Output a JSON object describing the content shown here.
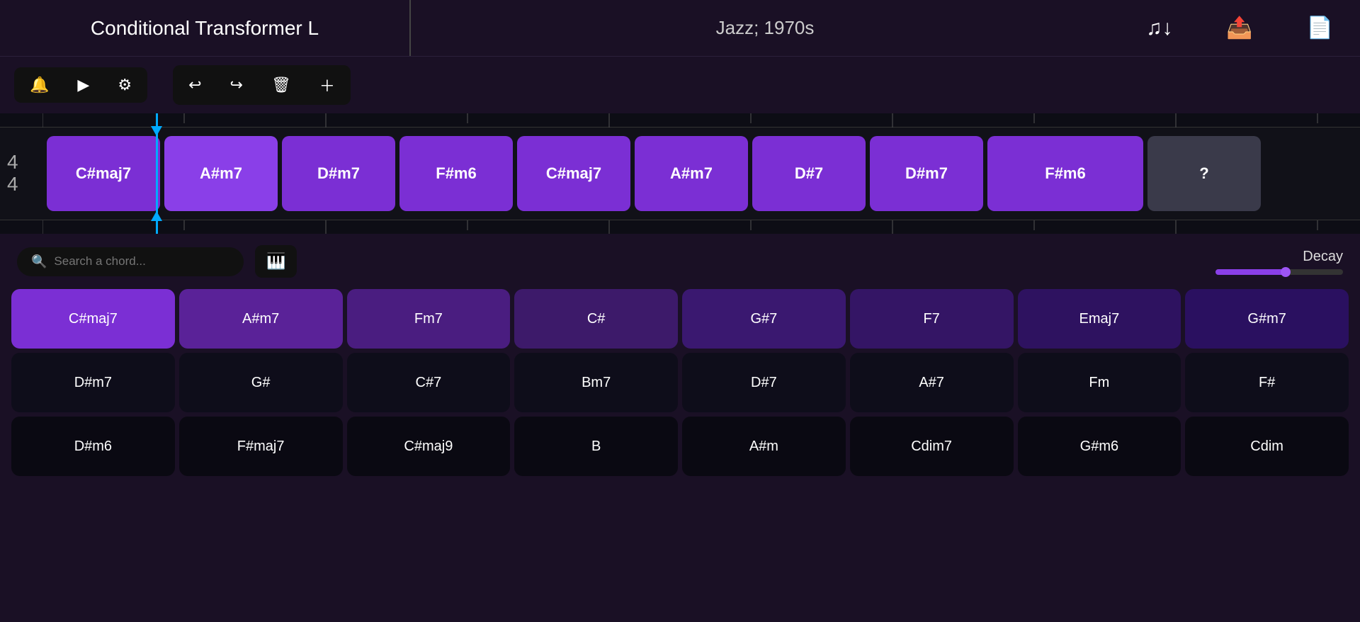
{
  "header": {
    "title": "Conditional Transformer L",
    "genre": "Jazz; 1970s",
    "icons": [
      "music-note-icon",
      "export-icon",
      "new-icon"
    ]
  },
  "toolbar": {
    "group1": [
      "bell-icon",
      "play-icon",
      "settings-icon"
    ],
    "group2": [
      "undo-icon",
      "redo-icon",
      "delete-icon",
      "add-icon"
    ]
  },
  "time_signature": {
    "top": "4",
    "bottom": "4"
  },
  "timeline_chords": [
    {
      "label": "C#maj7",
      "type": "normal"
    },
    {
      "label": "A#m7",
      "type": "active"
    },
    {
      "label": "D#m7",
      "type": "normal"
    },
    {
      "label": "F#m6",
      "type": "normal"
    },
    {
      "label": "C#maj7",
      "type": "normal"
    },
    {
      "label": "A#m7",
      "type": "normal"
    },
    {
      "label": "D#7",
      "type": "normal"
    },
    {
      "label": "D#m7",
      "type": "normal"
    },
    {
      "label": "F#m6",
      "type": "wide"
    },
    {
      "label": "?",
      "type": "unknown"
    }
  ],
  "search": {
    "placeholder": "Search a chord..."
  },
  "decay": {
    "label": "Decay",
    "value": 55
  },
  "chord_rows": [
    [
      {
        "label": "C#maj7",
        "style": "row1-0"
      },
      {
        "label": "A#m7",
        "style": "row1-1"
      },
      {
        "label": "Fm7",
        "style": "row1-2"
      },
      {
        "label": "C#",
        "style": "row1-3"
      },
      {
        "label": "G#7",
        "style": "row1-4"
      },
      {
        "label": "F7",
        "style": "row1-5"
      },
      {
        "label": "Emaj7",
        "style": "row1-6"
      },
      {
        "label": "G#m7",
        "style": "row1-7"
      }
    ],
    [
      {
        "label": "D#m7",
        "style": "row2"
      },
      {
        "label": "G#",
        "style": "row2"
      },
      {
        "label": "C#7",
        "style": "row2"
      },
      {
        "label": "Bm7",
        "style": "row2"
      },
      {
        "label": "D#7",
        "style": "row2"
      },
      {
        "label": "A#7",
        "style": "row2"
      },
      {
        "label": "Fm",
        "style": "row2"
      },
      {
        "label": "F#",
        "style": "row2"
      }
    ],
    [
      {
        "label": "D#m6",
        "style": "row3"
      },
      {
        "label": "F#maj7",
        "style": "row3"
      },
      {
        "label": "C#maj9",
        "style": "row3"
      },
      {
        "label": "B",
        "style": "row3"
      },
      {
        "label": "A#m",
        "style": "row3"
      },
      {
        "label": "Cdim7",
        "style": "row3"
      },
      {
        "label": "G#m6",
        "style": "row3"
      },
      {
        "label": "Cdim",
        "style": "row3"
      }
    ]
  ]
}
